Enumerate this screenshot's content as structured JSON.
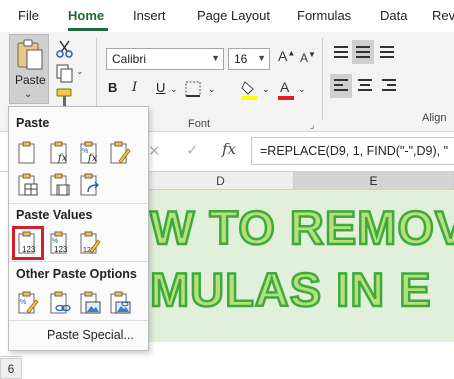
{
  "ribbon_tabs": [
    "File",
    "Home",
    "Insert",
    "Page Layout",
    "Formulas",
    "Data",
    "Rev"
  ],
  "active_tab": "Home",
  "clipboard": {
    "paste_label": "Paste"
  },
  "font": {
    "name": "Calibri",
    "size": "16",
    "bold": "B",
    "italic": "I",
    "underline": "U",
    "group_label": "Font"
  },
  "alignment": {
    "group_label": "Align"
  },
  "formula_bar": {
    "fx_label": "fx",
    "cancel_symbol": "✕",
    "confirm_symbol": "✓",
    "formula": "=REPLACE(D9, 1, FIND(\"-\",D9), \""
  },
  "columns": [
    "D",
    "E"
  ],
  "selected_column": "E",
  "rows": [
    "6"
  ],
  "sheet_banner": {
    "line1": "W TO REMOV",
    "line2": "MULAS IN E"
  },
  "paste_menu": {
    "section_paste": "Paste",
    "section_values": "Paste Values",
    "section_other": "Other Paste Options",
    "paste_special": "Paste Special..."
  },
  "colors": {
    "accent_green": "#1e6b3a",
    "banner_fill": "#b8e07a",
    "banner_outline": "#3cab3c",
    "selection_red": "#d2202a"
  }
}
